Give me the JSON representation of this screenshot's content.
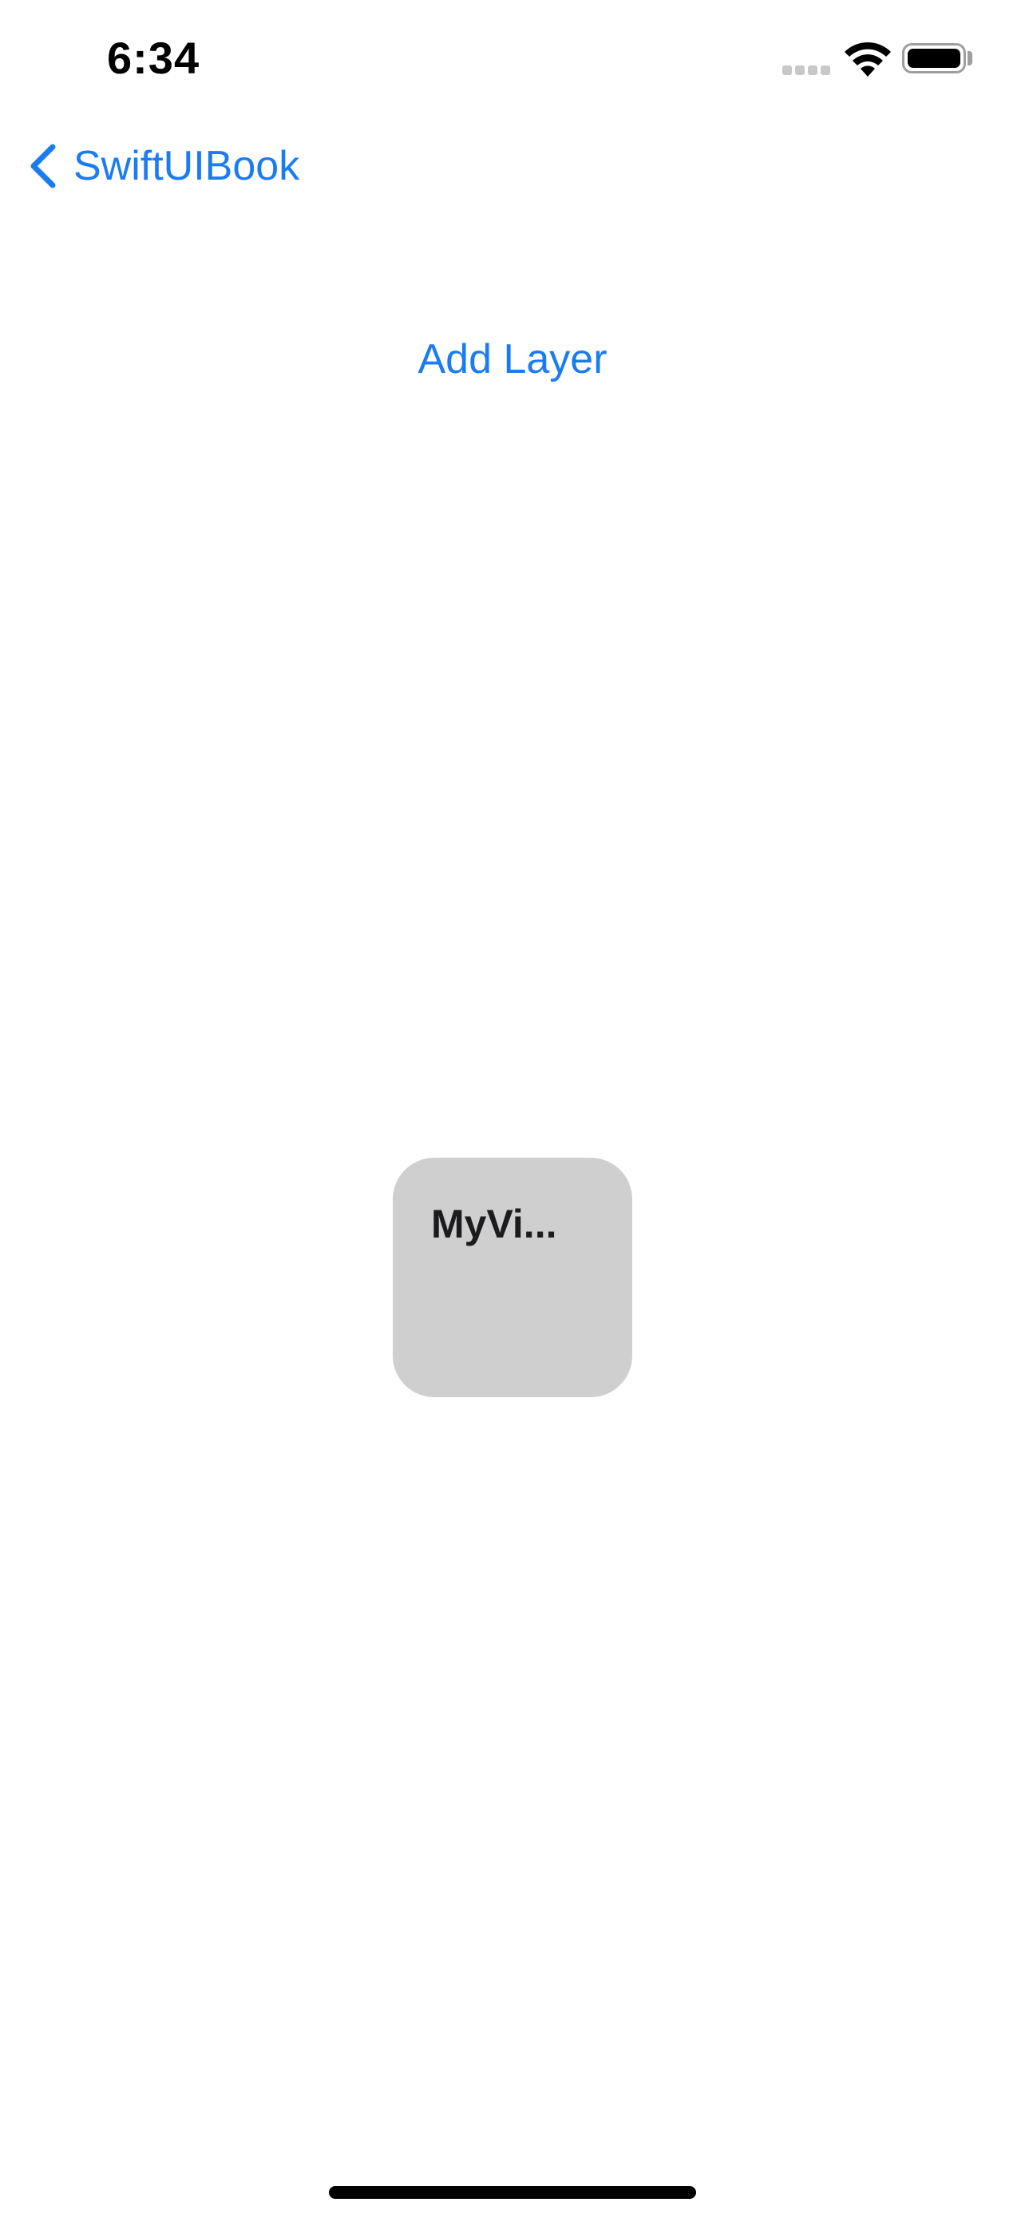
{
  "status_bar": {
    "time": "6:34",
    "signal_icon": "cellular-signal-icon",
    "wifi_icon": "wifi-icon",
    "battery_icon": "battery-icon",
    "battery_level": 1.0
  },
  "nav": {
    "back_label": "SwiftUIBook",
    "back_icon": "chevron-left-icon"
  },
  "main": {
    "add_layer_label": "Add Layer",
    "layer_card": {
      "title": "MyVi..."
    }
  },
  "colors": {
    "accent": "#1a7cf2",
    "card_background": "#cfcfcf",
    "background": "#ffffff"
  }
}
